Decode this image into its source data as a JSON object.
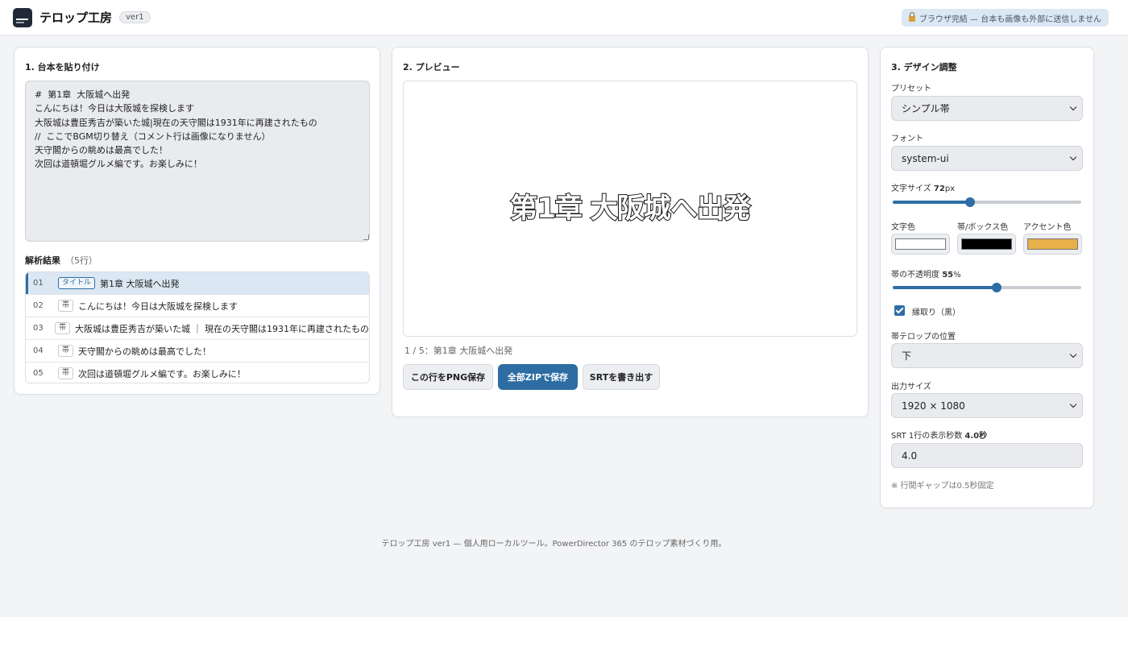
{
  "header": {
    "app_title": "テロップ工房",
    "version": "ver1",
    "privacy_notice": "ブラウザ完結 — 台本も画像も外部に送信しません"
  },
  "script_panel": {
    "title": "1. 台本を貼り付け",
    "script_text": "#  第1章  大阪城へ出発\nこんにちは！今日は大阪城を探検します\n大阪城は豊臣秀吉が築いた城|現在の天守閣は1931年に再建されたもの\n//  ここでBGM切り替え（コメント行は画像になりません）\n天守閣からの眺めは最高でした！\n次回は道頓堀グルメ編です。お楽しみに！",
    "result_heading": "解析結果",
    "result_count": "（5行）",
    "results": [
      {
        "num": "01",
        "tag": "タイトル",
        "text": "第1章 大阪城へ出発"
      },
      {
        "num": "02",
        "tag": "帯",
        "text": "こんにちは！今日は大阪城を探検します"
      },
      {
        "num": "03",
        "tag": "帯",
        "text": "大阪城は豊臣秀吉が築いた城 ｜ 現在の天守閣は1931年に再建されたもの"
      },
      {
        "num": "04",
        "tag": "帯",
        "text": "天守閣からの眺めは最高でした！"
      },
      {
        "num": "05",
        "tag": "帯",
        "text": "次回は道頓堀グルメ編です。お楽しみに！"
      }
    ]
  },
  "preview_panel": {
    "title": "2. プレビュー",
    "preview_text": "第1章 大阪城へ出発",
    "status": "1 / 5：第1章 大阪城へ出発",
    "save_png_label": "この行をPNG保存",
    "save_zip_label": "全部ZIPで保存",
    "export_srt_label": "SRTを書き出す"
  },
  "design_panel": {
    "title": "3. デザイン調整",
    "preset_label": "プリセット",
    "preset_value": "シンプル帯",
    "font_label": "フォント",
    "font_value": "system-ui",
    "font_size_label": "文字サイズ",
    "font_size_value": "72",
    "font_size_unit": "px",
    "font_size_fraction": 0.41,
    "text_color_label": "文字色",
    "band_color_label": "帯/ボックス色",
    "accent_color_label": "アクセント色",
    "text_color": "#ffffff",
    "band_color": "#000000",
    "accent_color": "#e8b04a",
    "opacity_label": "帯の不透明度",
    "opacity_value": "55",
    "opacity_unit": "%",
    "opacity_fraction": 0.55,
    "outline_label": "縁取り（黒）",
    "outline_checked": true,
    "position_label": "帯テロップの位置",
    "position_value": "下",
    "output_size_label": "出力サイズ",
    "output_size_value": "1920 × 1080",
    "srt_duration_label": "SRT 1行の表示秒数",
    "srt_duration_display": "4.0秒",
    "srt_duration_value": "4.0",
    "gap_note": "※ 行間ギャップは0.5秒固定"
  },
  "footer": {
    "text": "テロップ工房 ver1 — 個人用ローカルツール。PowerDirector 365 のテロップ素材づくり用。"
  },
  "colors": {
    "accent": "#2d6da3",
    "background": "#f3f4f6"
  }
}
